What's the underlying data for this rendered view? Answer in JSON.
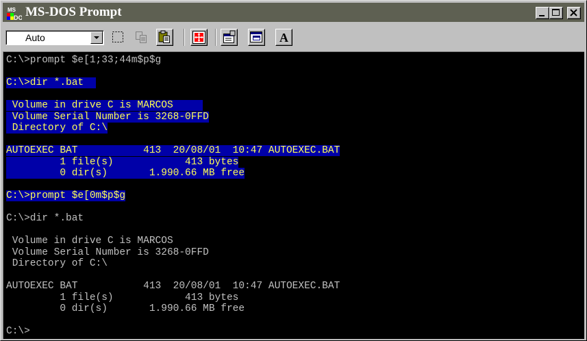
{
  "window": {
    "title": "MS-DOS Prompt",
    "controls": {
      "minimize": "minimize",
      "maximize": "maximize",
      "close": "close"
    }
  },
  "toolbar": {
    "font_select_value": "Auto",
    "buttons": [
      "mark-icon",
      "copy-icon",
      "paste-icon",
      "full-screen-icon",
      "properties-icon",
      "background-icon",
      "font-icon"
    ],
    "font_button_label": "A"
  },
  "colors": {
    "console_bg": "#000000",
    "console_fg": "#c0c0c0",
    "highlight_bg": "#0000a8",
    "highlight_fg": "#ffff55",
    "titlebar": "#5e6052"
  },
  "console": {
    "line1": "C:\\>prompt $e[1;33;44m$p$g",
    "line2": "C:\\>dir *.bat  ",
    "line3": " Volume in drive C is MARCOS     ",
    "line4": " Volume Serial Number is 3268-0FFD",
    "line5": " Directory of C:\\",
    "line6": "AUTOEXEC BAT           413  20/08/01  10:47 AUTOEXEC.BAT",
    "line7": "         1 file(s)            413 bytes",
    "line8": "         0 dir(s)       1.990.66 MB free",
    "line9": "C:\\>prompt $e[0m$p$g",
    "line10": "C:\\>dir *.bat",
    "line11": " Volume in drive C is MARCOS",
    "line12": " Volume Serial Number is 3268-0FFD",
    "line13": " Directory of C:\\",
    "line14": "AUTOEXEC BAT           413  20/08/01  10:47 AUTOEXEC.BAT",
    "line15": "         1 file(s)            413 bytes",
    "line16": "         0 dir(s)       1.990.66 MB free",
    "line17": "C:\\>"
  }
}
